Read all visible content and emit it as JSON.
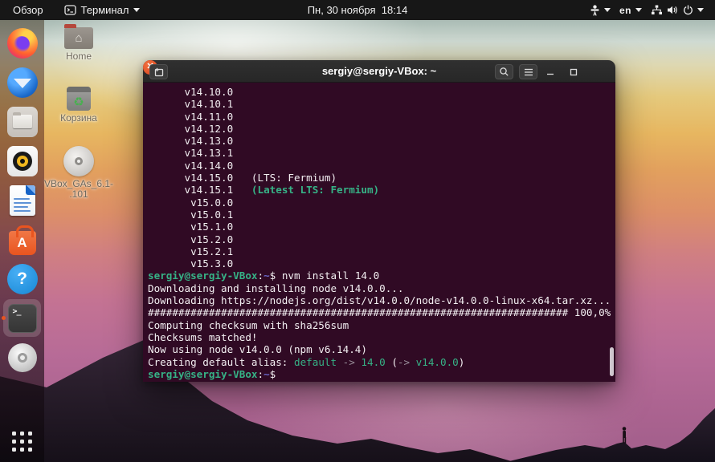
{
  "topbar": {
    "activities": "Обзор",
    "app_name": "Терминал",
    "clock": "Пн, 30 ноября  18:14",
    "keyboard_layout": "en",
    "indicator_icons": [
      "accessibility-icon",
      "keyboard-layout",
      "network-icon",
      "volume-icon",
      "power-icon"
    ]
  },
  "dock": {
    "items": [
      "firefox",
      "thunderbird",
      "files",
      "rhythmbox",
      "libreoffice-writer",
      "ubuntu-software",
      "help",
      "terminal",
      "disc",
      "show-applications"
    ],
    "active_item": "terminal",
    "running_indicator_color": "#e95420"
  },
  "desktop_icons": {
    "home": {
      "label": "Home"
    },
    "trash": {
      "label": "Корзина"
    },
    "vbox_cd": {
      "label_line1": "VBox_GAs_6.1-",
      "label_line2": ".101"
    }
  },
  "terminal": {
    "title": "sergiy@sergiy-VBox: ~",
    "background_color": "#300a24",
    "prompt_color": "#36b286",
    "lines": [
      [
        [
          "w",
          "      v14.10.0"
        ]
      ],
      [
        [
          "w",
          "      v14.10.1"
        ]
      ],
      [
        [
          "w",
          "      v14.11.0"
        ]
      ],
      [
        [
          "w",
          "      v14.12.0"
        ]
      ],
      [
        [
          "w",
          "      v14.13.0"
        ]
      ],
      [
        [
          "w",
          "      v14.13.1"
        ]
      ],
      [
        [
          "w",
          "      v14.14.0"
        ]
      ],
      [
        [
          "w",
          "      v14.15.0   (LTS: Fermium)"
        ]
      ],
      [
        [
          "w",
          "      v14.15.1   "
        ],
        [
          "gb",
          "(Latest LTS: Fermium)"
        ]
      ],
      [
        [
          "w",
          "       v15.0.0"
        ]
      ],
      [
        [
          "w",
          "       v15.0.1"
        ]
      ],
      [
        [
          "w",
          "       v15.1.0"
        ]
      ],
      [
        [
          "w",
          "       v15.2.0"
        ]
      ],
      [
        [
          "w",
          "       v15.2.1"
        ]
      ],
      [
        [
          "w",
          "       v15.3.0"
        ]
      ],
      [
        [
          "ub",
          "sergiy@sergiy-VBox"
        ],
        [
          "w",
          ":"
        ],
        [
          "b",
          "~"
        ],
        [
          "w",
          "$ nvm install 14.0"
        ]
      ],
      [
        [
          "w",
          "Downloading and installing node v14.0.0..."
        ]
      ],
      [
        [
          "w",
          "Downloading https://nodejs.org/dist/v14.0.0/node-v14.0.0-linux-x64.tar.xz..."
        ]
      ],
      [
        [
          "w",
          "##################################################################### 100,0%"
        ]
      ],
      [
        [
          "w",
          "Computing checksum with sha256sum"
        ]
      ],
      [
        [
          "w",
          "Checksums matched!"
        ]
      ],
      [
        [
          "w",
          "Now using node v14.0.0 (npm v6.14.4)"
        ]
      ],
      [
        [
          "w",
          "Creating default alias: "
        ],
        [
          "g",
          "default"
        ],
        [
          "d",
          " -> "
        ],
        [
          "g",
          "14.0"
        ],
        [
          "w",
          " ("
        ],
        [
          "d",
          "-> "
        ],
        [
          "g",
          "v14.0.0"
        ],
        [
          "w",
          ")"
        ]
      ],
      [
        [
          "ub",
          "sergiy@sergiy-VBox"
        ],
        [
          "w",
          ":"
        ],
        [
          "b",
          "~"
        ],
        [
          "w",
          "$ "
        ]
      ]
    ]
  }
}
